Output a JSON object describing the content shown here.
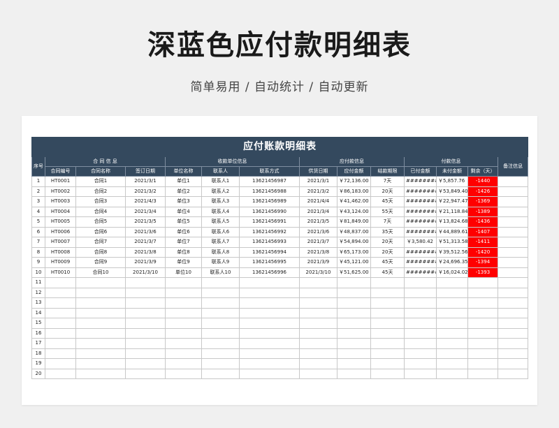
{
  "header": {
    "title": "深蓝色应付款明细表",
    "subtitle": "简单易用 / 自动统计 / 自动更新"
  },
  "table": {
    "title": "应付账款明细表",
    "groups": {
      "seq": "序号",
      "contract": "合 同 信 息",
      "payee": "收款单位信息",
      "payable": "应付款信息",
      "payment": "付款信息",
      "note": "备注信息"
    },
    "columns": [
      "合同编号",
      "合同名称",
      "签订日期",
      "单位名称",
      "联系人",
      "联系方式",
      "供货日期",
      "应付金额",
      "结款期限",
      "已付金额",
      "未付金额",
      "剩余（天）"
    ],
    "rows": [
      {
        "seq": "1",
        "id": "HT0001",
        "name": "合同1",
        "sign": "2021/3/1",
        "unit": "单位1",
        "contact": "联系人1",
        "phone": "13621456987",
        "supply": "2021/3/1",
        "amount": "￥72,136.00",
        "term": "7天",
        "paid": "##########",
        "unpaid": "￥5,857.76",
        "remain": "-1440"
      },
      {
        "seq": "2",
        "id": "HT0002",
        "name": "合同2",
        "sign": "2021/3/2",
        "unit": "单位2",
        "contact": "联系人2",
        "phone": "13621456988",
        "supply": "2021/3/2",
        "amount": "￥86,183.00",
        "term": "20天",
        "paid": "##########",
        "unpaid": "￥53,849.40",
        "remain": "-1426"
      },
      {
        "seq": "3",
        "id": "HT0003",
        "name": "合同3",
        "sign": "2021/4/3",
        "unit": "单位3",
        "contact": "联系人3",
        "phone": "13621456989",
        "supply": "2021/4/4",
        "amount": "￥41,462.00",
        "term": "45天",
        "paid": "##########",
        "unpaid": "￥22,947.47",
        "remain": "-1369"
      },
      {
        "seq": "4",
        "id": "HT0004",
        "name": "合同4",
        "sign": "2021/3/4",
        "unit": "单位4",
        "contact": "联系人4",
        "phone": "13621456990",
        "supply": "2021/3/4",
        "amount": "￥43,124.00",
        "term": "55天",
        "paid": "##########",
        "unpaid": "￥21,118.84",
        "remain": "-1389"
      },
      {
        "seq": "5",
        "id": "HT0005",
        "name": "合同5",
        "sign": "2021/3/5",
        "unit": "单位5",
        "contact": "联系人5",
        "phone": "13621456991",
        "supply": "2021/3/5",
        "amount": "￥81,849.00",
        "term": "7天",
        "paid": "##########",
        "unpaid": "￥13,824.68",
        "remain": "-1436"
      },
      {
        "seq": "6",
        "id": "HT0006",
        "name": "合同6",
        "sign": "2021/3/6",
        "unit": "单位6",
        "contact": "联系人6",
        "phone": "13621456992",
        "supply": "2021/3/6",
        "amount": "￥48,837.00",
        "term": "35天",
        "paid": "##########",
        "unpaid": "￥44,889.61",
        "remain": "-1407"
      },
      {
        "seq": "7",
        "id": "HT0007",
        "name": "合同7",
        "sign": "2021/3/7",
        "unit": "单位7",
        "contact": "联系人7",
        "phone": "13621456993",
        "supply": "2021/3/7",
        "amount": "￥54,894.00",
        "term": "20天",
        "paid": "￥3,580.42",
        "unpaid": "￥51,313.58",
        "remain": "-1411"
      },
      {
        "seq": "8",
        "id": "HT0008",
        "name": "合同8",
        "sign": "2021/3/8",
        "unit": "单位8",
        "contact": "联系人8",
        "phone": "13621456994",
        "supply": "2021/3/8",
        "amount": "￥65,173.00",
        "term": "20天",
        "paid": "##########",
        "unpaid": "￥39,512.56",
        "remain": "-1420"
      },
      {
        "seq": "9",
        "id": "HT0009",
        "name": "合同9",
        "sign": "2021/3/9",
        "unit": "单位9",
        "contact": "联系人9",
        "phone": "13621456995",
        "supply": "2021/3/9",
        "amount": "￥45,121.00",
        "term": "45天",
        "paid": "##########",
        "unpaid": "￥24,696.35",
        "remain": "-1394"
      },
      {
        "seq": "10",
        "id": "HT0010",
        "name": "合同10",
        "sign": "2021/3/10",
        "unit": "单位10",
        "contact": "联系人10",
        "phone": "13621456996",
        "supply": "2021/3/10",
        "amount": "￥51,625.00",
        "term": "45天",
        "paid": "##########",
        "unpaid": "￥16,024.02",
        "remain": "-1393"
      }
    ],
    "empty_rows": [
      "11",
      "12",
      "13",
      "14",
      "15",
      "16",
      "17",
      "18",
      "19",
      "20"
    ]
  },
  "colors": {
    "header_bg": "#34495e",
    "overdue": "#ff0000"
  }
}
